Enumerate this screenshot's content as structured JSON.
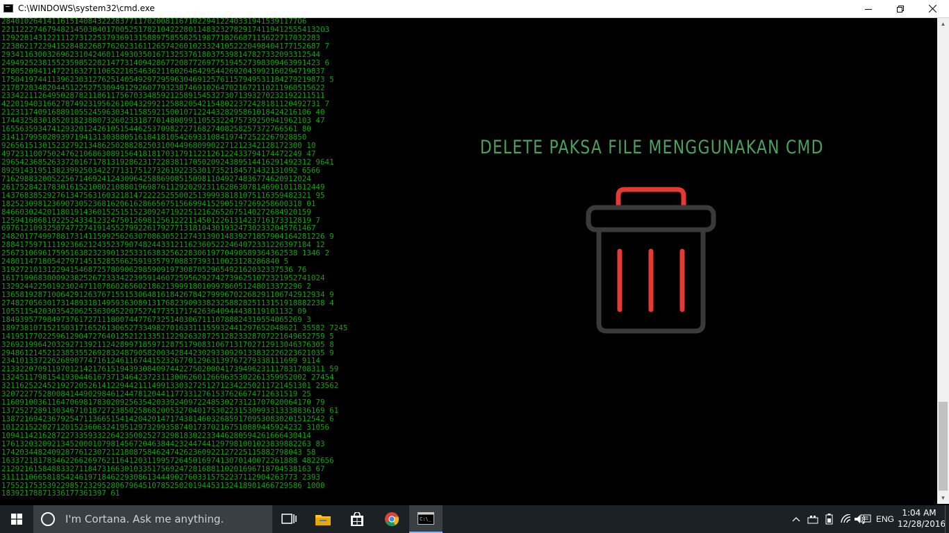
{
  "window": {
    "title": "C:\\WINDOWS\\system32\\cmd.exe",
    "controls": {
      "minimize_icon": "minimize-icon",
      "maximize_icon": "restore-icon",
      "close_icon": "close-icon"
    }
  },
  "console": {
    "text_color": "#13a10e",
    "lines": [
      "28401026414116151408432228377117020081167102294122403319415391177O6",
      "2211222746794821450384017005251782104222801148323278291741194125554132O3",
      "1292281431221112731225379369131588975855825198771826687115622717032283",
      "2238621722941528482268776262316112657426010233241052220498404177152687 7",
      "2934116300326962310424601149303501671325376180375398147827332093312544",
      "2494925238155235985228214773140942867720877269775194527398309463991423 6",
      "27805209411472216327110652216546362116026464295442692043992160294719837",
      "17504197441139623031276251405492972959630469125761157949531184279219873 5",
      "21787283482044512252753094912926077932387469102647021672110211960515622",
      "23342211264950287821186117567033485921258915453273071393270232192211511",
      "4220194031662787492319562610043299212588205421548022372428181120492731 7",
      "21231174091688910552459630341158592150010712244328295861018424216106 40",
      "17443258301852018238807326023318770148089911055322475739250941962103 47",
      "16556359347412932012426105154462537098272716827408258257372766561 80",
      "3141179950289397194131303880516184181054269331084197472522267928850",
      "926561513015232792134862502882825031004496809902271212342128172300 10",
      "497231100750247621068630891564181817031791122126122433794174472249 47",
      "29654236852633720167178131928623172283811705020924389514416291492312 9641",
      "89291431951382399250342277131751273261922353017352184571432131092 6566",
      "71629883200522567146924124309642588690851509811049274836774620912024",
      "26175284217830161521080210880196987611292029231162863078146901011812449",
      "14376838529276134756316032181472222525500251399938181075116359482321 95",
      "182523098123690730523681620616286656751566994152905197269258600318 01",
      "84660302420118019143601525151523092471922512162652675140272684920159",
      "12594168681922524334123247501269812561222114501226131423716173312819 7",
      "697612109325074772741914552799226179277131810430193247302332045761467",
      "24820177499788173141159925626307086305212743139014839271857904164281226 9",
      "28841759711119236621243523790748244331211623605222464072331226397184 12",
      "25673106961759516382323901325331638325622830619770490589364362538 1346 2",
      "2480114718054279714515285566259193579708837393110023128286840 5",
      "3192721013122941546872578090629859091973087052965492162032337536 76",
      "16171996830009238252672333422395914607259562927427396251072321952741024",
      "132924422501923024711078602656021862139991801099786051248013372296 2",
      "13658192871006429126376715515306481618426784279996702268291106742912934 9",
      "27482705630173148931814959363089131768239093382325882825113151918882238 4",
      "1055115420303542062536309522075274773517174263640944438119101132 09",
      "184939577984973761727111800744776732514030671110788824319554065269 3",
      "18973810715215031716526130652733498270163311155932441297652048621 35582 7245",
      "14195177022596129047276401252121335112292632872512823328707221649652759 5",
      "32692199642032927139211242899718597128751790831067131702712913046376305 8",
      "29486121452123853552692832487905820034284423029330929133832226223621035 9",
      "23410133722626890774716124611674415232677012963139767279338111699 9114",
      "21332207091197012142176151943930840974422750200041739496231117831708311 59",
      "1324511798154193044616737134642372311300626012669635302261359952002 27454",
      "32116252245219272052614122944211149913303272512712342250211721451301 23562",
      "32072277528008414490298461244781204411773312761537626674712631519 25",
      "11609100361164706981783020925635420339240972248530273121707020064170 79",
      "13725272891303467101872723850258682005327040175302231530993313338836169 61",
      "13872169423679254711366515414204201471743814603268591709530830201512542 6",
      "101221522027120152360632419512973299358740173702167510889445924232 31056",
      "10941142162872273359332264235002527329818302233446280594261666430414",
      "17613203209213452000107981456720463844232447441297981001023839882263 83",
      "174203448240928776123072121808758462474262360922127225115882798043 58",
      "16337218178346226626976211641203119957264501697413070140072261888 4822656",
      "21292161584883327118473166301033517569247281688110201696718704538163 67",
      "31111106658185424619718462293086134449027603315752237112904263773 2393",
      "175521753539229857232952806796451078525020194453132418901466729586 1000",
      "18392178871336177361397 61"
    ]
  },
  "overlay": {
    "title": "DELETE PAKSA FILE MENGGUNAKAN CMD",
    "title_color": "#4aa35a",
    "icon": "trash-can-icon",
    "icon_accent_color": "#e53935",
    "icon_body_color": "#3a3a3a"
  },
  "taskbar": {
    "start_icon": "windows-logo-icon",
    "search_placeholder": "I'm Cortana. Ask me anything.",
    "apps": [
      "task-view-icon",
      "file-explorer-icon",
      "store-icon",
      "chrome-icon",
      "cmd-icon"
    ],
    "active_app": "cmd-icon",
    "tray": {
      "language": "ENG",
      "time": "1:04 AM",
      "date": "12/28/2016"
    }
  }
}
